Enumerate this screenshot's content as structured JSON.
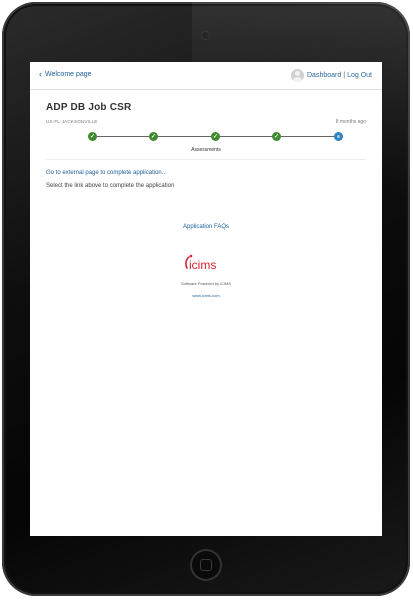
{
  "nav": {
    "back_label": "Welcome page",
    "dashboard_label": "Dashboard",
    "separator": "|",
    "logout_label": "Log Out"
  },
  "job": {
    "title": "ADP DB Job CSR",
    "location": "US-FL-JACKSONVILLE",
    "posted": "8 months ago"
  },
  "progress": {
    "steps": [
      {
        "state": "done",
        "glyph": "✓"
      },
      {
        "state": "done",
        "glyph": "✓"
      },
      {
        "state": "done",
        "glyph": "✓"
      },
      {
        "state": "done",
        "glyph": "✓"
      },
      {
        "state": "current",
        "glyph": "6"
      }
    ],
    "current_label": "Assessments"
  },
  "content": {
    "external_link": "Go to external page to complete application...",
    "instructions": "Select the link above to complete the application"
  },
  "footer": {
    "faq_label": "Application FAQs",
    "logo_text": "icims",
    "powered_by": "Software Powered by iCIMS",
    "site_url": "www.icims.com"
  },
  "colors": {
    "link": "#1f5f9a",
    "step_done": "#3f8a2e",
    "step_current": "#2b7fbf",
    "logo_red": "#d6202f"
  }
}
